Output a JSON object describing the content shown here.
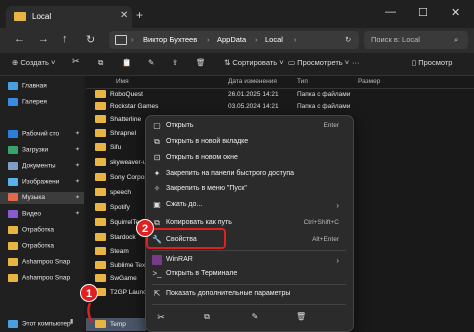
{
  "tab": {
    "title": "Local"
  },
  "address": {
    "crumbs": [
      "Виктор Бухтеев",
      "AppData",
      "Local"
    ]
  },
  "search": {
    "placeholder": "Поиск в: Local"
  },
  "toolbar": {
    "create": "Создать",
    "sort": "Сортировать",
    "view": "Просмотреть",
    "preview": "Просмотр"
  },
  "sidebar": {
    "items": [
      {
        "label": "Главная"
      },
      {
        "label": "Галерея"
      },
      {
        "label": "Рабочий сто"
      },
      {
        "label": "Загрузки"
      },
      {
        "label": "Документы"
      },
      {
        "label": "Изображени"
      },
      {
        "label": "Музыка"
      },
      {
        "label": "Видео"
      },
      {
        "label": "Отработка"
      },
      {
        "label": "Отработка"
      },
      {
        "label": "Ashampoo Snap"
      },
      {
        "label": "Ashampoo Snap"
      },
      {
        "label": "Этот компьютер"
      }
    ]
  },
  "columns": {
    "name": "Имя",
    "date": "Дата изменения",
    "type": "Тип",
    "size": "Размер"
  },
  "files": [
    {
      "name": "RoboQuest",
      "date": "26.01.2025 14:21",
      "type": "Папка с файлами"
    },
    {
      "name": "Rockstar Games",
      "date": "03.05.2024 14:21",
      "type": "Папка с файлами"
    },
    {
      "name": "Shatterline"
    },
    {
      "name": "Shrapnel"
    },
    {
      "name": "Sifu"
    },
    {
      "name": "skyweaver-updater"
    },
    {
      "name": "Sony Corporation"
    },
    {
      "name": "speech"
    },
    {
      "name": "Spotify"
    },
    {
      "name": "SquirrelTemp"
    },
    {
      "name": "Stardock"
    },
    {
      "name": "Steam"
    },
    {
      "name": "Sublime Text"
    },
    {
      "name": "SwGame"
    },
    {
      "name": "T2GP Launcher"
    },
    {
      "name": "Temp"
    }
  ],
  "menu": {
    "open": "Открыть",
    "open_shortcut": "Enter",
    "open_new_tab": "Открыть в новой вкладке",
    "open_new_window": "Открыть в новом окне",
    "pin_quick": "Закрепить на панели быстрого доступа",
    "pin_start": "Закрепить в меню \"Пуск\"",
    "compress": "Сжать до...",
    "copy_path": "Копировать как путь",
    "copy_path_shortcut": "Ctrl+Shift+C",
    "properties": "Свойства",
    "properties_shortcut": "Alt+Enter",
    "winrar": "WinRAR",
    "open_terminal": "Открыть в Терминале",
    "more_options": "Показать дополнительные параметры"
  },
  "badges": {
    "step1": "1",
    "step2": "2"
  },
  "colors": {
    "highlight": "#e02020",
    "folder": "#e8b444"
  }
}
